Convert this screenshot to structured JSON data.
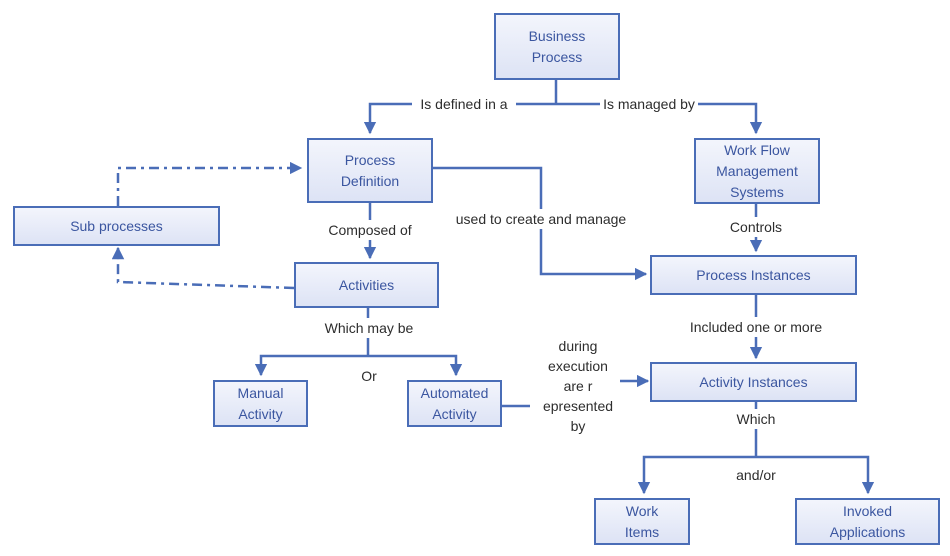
{
  "diagram": {
    "type": "concept-flowchart",
    "colors": {
      "box_border": "#4a6db7",
      "box_fill_top": "#f3f5fc",
      "box_fill_bottom": "#dde3f5",
      "box_text": "#3b56a0",
      "label_text": "#2d2d2d",
      "connector": "#4a6db7"
    },
    "nodes": {
      "business_process": "Business\nProcess",
      "process_definition": "Process\nDefinition",
      "workflow_mgmt": "Work Flow\nManagement\nSystems",
      "sub_processes": "Sub processes",
      "activities": "Activities",
      "process_instances": "Process Instances",
      "manual_activity": "Manual\nActivity",
      "automated_activity": "Automated\nActivity",
      "activity_instances": "Activity Instances",
      "work_items": "Work\nItems",
      "invoked_applications": "Invoked\nApplications"
    },
    "labels": {
      "is_defined_in": "Is defined in a",
      "is_managed_by": "Is managed by",
      "composed_of": "Composed of",
      "used_to_create": "used to create and manage",
      "controls": "Controls",
      "which_may_be": "Which may be",
      "or": "Or",
      "included": "Included one or more",
      "during_execution": "during\nexecution\nare r\nepresented\nby",
      "which": "Which",
      "and_or": "and/or"
    },
    "edges": [
      {
        "from": "Business Process",
        "to": "Process Definition",
        "label": "Is defined in a",
        "style": "solid"
      },
      {
        "from": "Business Process",
        "to": "Work Flow Management Systems",
        "label": "Is managed by",
        "style": "solid"
      },
      {
        "from": "Process Definition",
        "to": "Activities",
        "label": "Composed of",
        "style": "solid"
      },
      {
        "from": "Process Definition",
        "to": "Process Instances",
        "label": "used to create and manage",
        "style": "solid"
      },
      {
        "from": "Work Flow Management Systems",
        "to": "Process Instances",
        "label": "Controls",
        "style": "solid"
      },
      {
        "from": "Sub processes",
        "to": "Process Definition",
        "label": "",
        "style": "dash-dot"
      },
      {
        "from": "Activities",
        "to": "Sub processes",
        "label": "",
        "style": "dash-dot"
      },
      {
        "from": "Activities",
        "to": "Manual Activity",
        "label": "Which may be / Or",
        "style": "solid"
      },
      {
        "from": "Activities",
        "to": "Automated Activity",
        "label": "Which may be / Or",
        "style": "solid"
      },
      {
        "from": "Automated Activity",
        "to": "Activity Instances",
        "label": "during execution are represented by",
        "style": "solid"
      },
      {
        "from": "Process Instances",
        "to": "Activity Instances",
        "label": "Included one or more",
        "style": "solid"
      },
      {
        "from": "Activity Instances",
        "to": "Work Items",
        "label": "Which / and/or",
        "style": "solid"
      },
      {
        "from": "Activity Instances",
        "to": "Invoked Applications",
        "label": "Which / and/or",
        "style": "solid"
      }
    ]
  }
}
